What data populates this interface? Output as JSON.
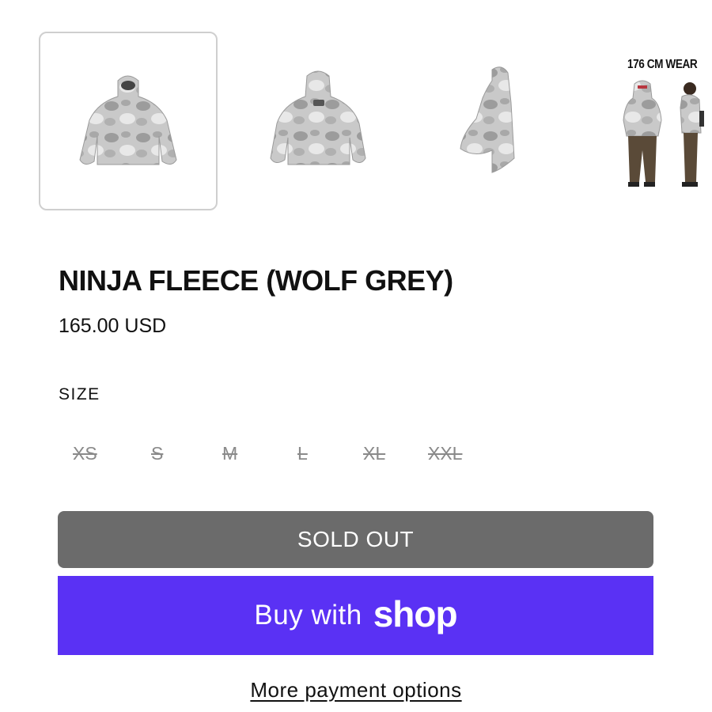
{
  "gallery": {
    "wear_label": "176 CM WEAR",
    "images": [
      {
        "name": "front-view",
        "selected": true
      },
      {
        "name": "back-view",
        "selected": false
      },
      {
        "name": "side-view",
        "selected": false
      },
      {
        "name": "model-view",
        "selected": false
      }
    ]
  },
  "product": {
    "title": "NINJA FLEECE (WOLF GREY)",
    "price": "165.00 USD",
    "size_label": "SIZE",
    "sizes": [
      "XS",
      "S",
      "M",
      "L",
      "XL",
      "XXL"
    ]
  },
  "actions": {
    "sold_out": "SOLD OUT",
    "buy_with": "Buy with",
    "shop_brand": "shop",
    "more_payment": "More payment options"
  },
  "colors": {
    "shop_purple": "#5a31f4",
    "sold_out_grey": "#6b6b6b",
    "strike_grey": "#8a8a8a"
  }
}
